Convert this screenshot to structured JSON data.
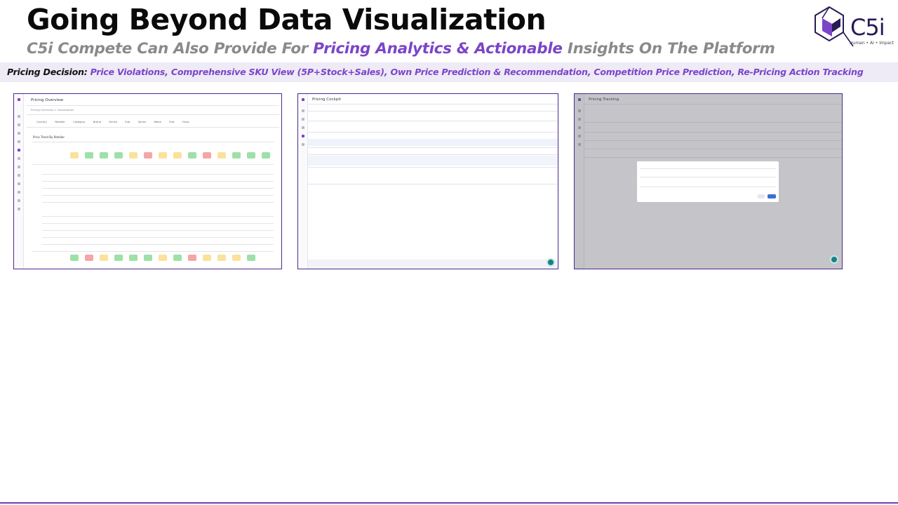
{
  "header": {
    "title": "Going Beyond Data Visualization",
    "subtitle_pre": "C5i Compete Can Also Provide For ",
    "subtitle_highlight": "Pricing Analytics & Actionable",
    "subtitle_post": " Insights On The Platform"
  },
  "logo": {
    "wordmark": "C5i",
    "tagline": "Human • AI • Impact"
  },
  "band": {
    "lead": "Pricing Decision:",
    "text": " Price Violations, Comprehensive SKU View (5P+Stock+Sales), Own Price Prediction & Recommendation, Competition Price Prediction, Re-Pricing Action Tracking"
  },
  "screenshots": {
    "s1": {
      "title": "Pricing Overview",
      "breadcrumb": "Pricing Overview  >  Visualization",
      "filters": [
        "Country",
        "Retailer",
        "Category",
        "Brand",
        "Series",
        "Sub Series",
        "Week",
        "Sub Class"
      ],
      "section": "Price Trend By Retailer"
    },
    "s2": {
      "title": "Pricing Cockpit"
    },
    "s3": {
      "title": "Pricing Tracking"
    }
  },
  "colors": {
    "accent": "#7b45c8",
    "frame": "#4b2a8a",
    "band": "#eeeaf6"
  }
}
